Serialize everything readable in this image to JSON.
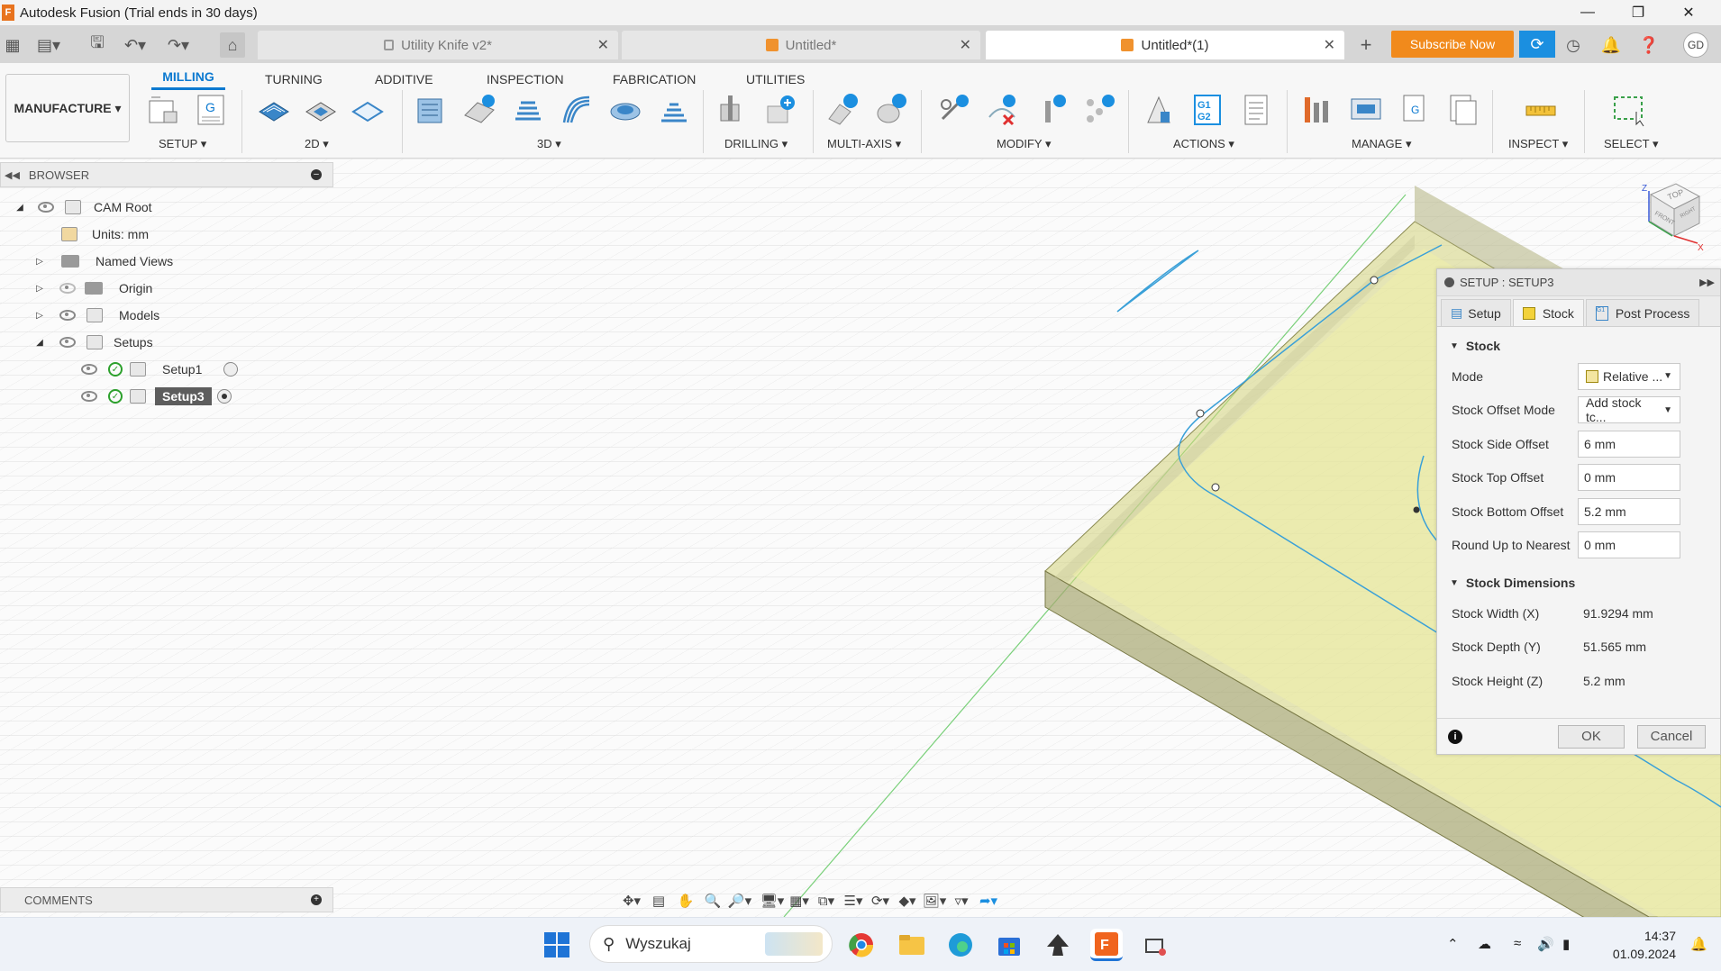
{
  "window": {
    "title": "Autodesk Fusion (Trial ends in 30 days)",
    "app_icon": "F"
  },
  "doc_tabs": [
    {
      "label": "Utility Knife v2*"
    },
    {
      "label": "Untitled*"
    },
    {
      "label": "Untitled*(1)"
    }
  ],
  "header": {
    "subscribe_label": "Subscribe Now",
    "avatar_initials": "GD"
  },
  "ribbon": {
    "workspace": "MANUFACTURE",
    "tabs": [
      "MILLING",
      "TURNING",
      "ADDITIVE",
      "INSPECTION",
      "FABRICATION",
      "UTILITIES"
    ],
    "groups": [
      "SETUP",
      "2D",
      "3D",
      "DRILLING",
      "MULTI-AXIS",
      "MODIFY",
      "ACTIONS",
      "MANAGE",
      "INSPECT",
      "SELECT"
    ]
  },
  "browser": {
    "title": "BROWSER",
    "items": [
      {
        "label": "CAM Root"
      },
      {
        "label": "Units: mm"
      },
      {
        "label": "Named Views"
      },
      {
        "label": "Origin"
      },
      {
        "label": "Models"
      },
      {
        "label": "Setups"
      },
      {
        "label": "Setup1"
      },
      {
        "label": "Setup3"
      }
    ]
  },
  "comments": {
    "title": "COMMENTS"
  },
  "dialog": {
    "title": "SETUP : SETUP3",
    "tabs": [
      "Setup",
      "Stock",
      "Post Process"
    ],
    "stock_section": "Stock",
    "fields": [
      {
        "label": "Mode",
        "value": "Relative ..."
      },
      {
        "label": "Stock Offset Mode",
        "value": "Add stock tc..."
      },
      {
        "label": "Stock Side Offset",
        "value": "6 mm"
      },
      {
        "label": "Stock Top Offset",
        "value": "0 mm"
      },
      {
        "label": "Stock Bottom Offset",
        "value": "5.2 mm"
      },
      {
        "label": "Round Up to Nearest",
        "value": "0 mm"
      }
    ],
    "dimensions_section": "Stock Dimensions",
    "dimensions": [
      {
        "label": "Stock Width (X)",
        "value": "91.9294 mm"
      },
      {
        "label": "Stock Depth (Y)",
        "value": "51.565 mm"
      },
      {
        "label": "Stock Height (Z)",
        "value": "5.2 mm"
      }
    ],
    "ok_label": "OK",
    "cancel_label": "Cancel"
  },
  "viewcube": {
    "top": "TOP",
    "front": "FRONT",
    "right": "RIGHT",
    "axis_z": "Z",
    "axis_x": "X"
  },
  "taskbar": {
    "search_placeholder": "Wyszukaj",
    "time": "14:37",
    "date": "01.09.2024"
  },
  "colors": {
    "accent": "#0b79d0",
    "subscribe": "#f18a1c",
    "stock": "#c7c78a",
    "toolpath": "#3aa0d8"
  }
}
